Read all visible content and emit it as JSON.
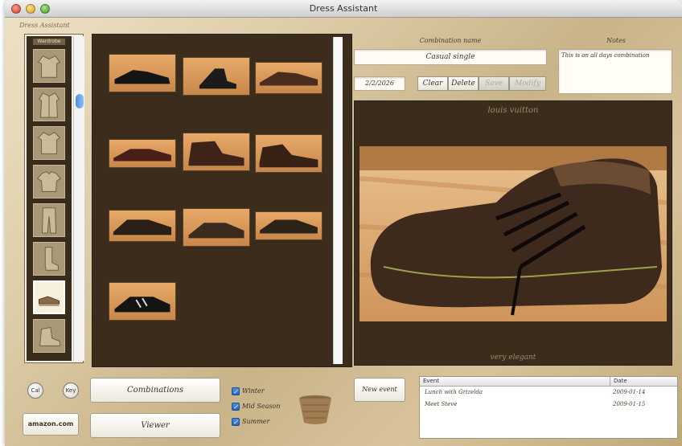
{
  "window": {
    "title": "Dress Assistant",
    "subtitle": "Dress Assistant"
  },
  "categories": {
    "header": "Wardrobe",
    "items": [
      {
        "name": "jacket"
      },
      {
        "name": "coat"
      },
      {
        "name": "shirt"
      },
      {
        "name": "t-shirt"
      },
      {
        "name": "trousers"
      },
      {
        "name": "socks"
      },
      {
        "name": "shoes",
        "selected": true
      },
      {
        "name": "boots"
      }
    ]
  },
  "grid": {
    "count": 10
  },
  "combination": {
    "name_label": "Combination name",
    "name_value": "Casual single",
    "notes_label": "Notes",
    "notes_value": "This is an all days combination",
    "date": "2/2/2026"
  },
  "toolbar": {
    "clear": "Clear",
    "delete": "Delete",
    "save": "Save",
    "modify": "Modify"
  },
  "viewer": {
    "title": "louis vuitton",
    "subtitle": "very elegant"
  },
  "bottom": {
    "round_left": "Cal",
    "round_right": "Key",
    "amazon": "amazon.com",
    "combinations": "Combinations",
    "viewer": "Viewer",
    "new_event": "New event",
    "checks": [
      "Winter",
      "Mid Season",
      "Summer"
    ]
  },
  "events": {
    "columns": [
      "Event",
      "Date"
    ],
    "rows": [
      {
        "event": "Lunch with Grizelda",
        "date": "2009-01-14"
      },
      {
        "event": "Meet Steve",
        "date": "2009-01-15"
      }
    ]
  }
}
